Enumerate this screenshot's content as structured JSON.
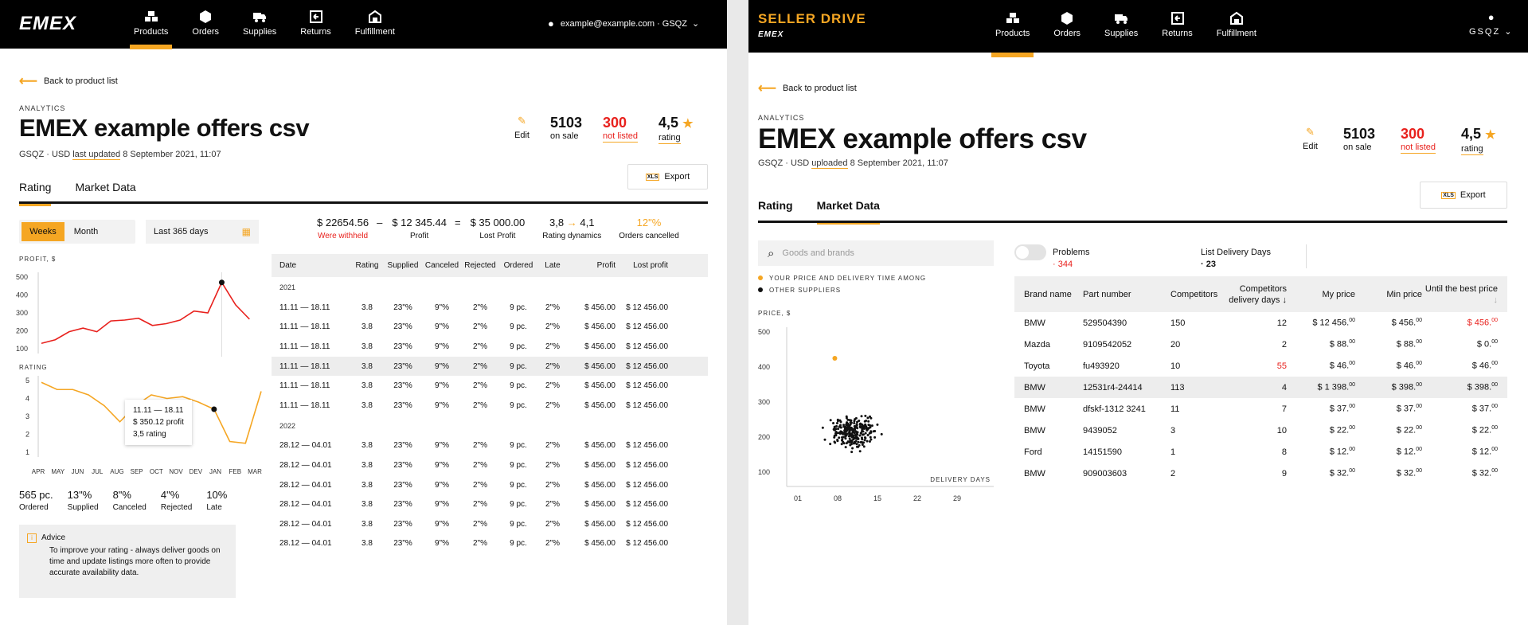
{
  "left": {
    "logo": "EMEX",
    "nav": [
      {
        "label": "Products",
        "icon": "boxes-icon",
        "active": true
      },
      {
        "label": "Orders",
        "icon": "box-icon",
        "active": false
      },
      {
        "label": "Supplies",
        "icon": "truck-icon",
        "active": false
      },
      {
        "label": "Returns",
        "icon": "return-icon",
        "active": false
      },
      {
        "label": "Fulfillment",
        "icon": "warehouse-icon",
        "active": false
      }
    ],
    "account": "example@example.com · GSQZ",
    "back_label": "Back to product list",
    "crumb": "ANALYTICS",
    "title": "EMEX example offers csv",
    "sub_prefix": "GSQZ · USD",
    "sub_link": "last updated",
    "sub_date": "8 September 2021, 11:07",
    "edit_label": "Edit",
    "on_sale_value": "5103",
    "on_sale_label": "on sale",
    "not_listed_value": "300",
    "not_listed_label": "not listed",
    "rating_value": "4,5",
    "rating_label": "rating",
    "export_label": "Export",
    "xls": "XLS",
    "tabs": [
      "Rating",
      "Market Data"
    ],
    "period": {
      "weeks": "Weeks",
      "month": "Month"
    },
    "date_range": "Last 365 days",
    "summary": {
      "withheld": "$ 22654.56",
      "withheld_label": "Were withheld",
      "minus": "–",
      "profit": "$ 12 345.44",
      "profit_label": "Profit",
      "eq": "=",
      "lost": "$ 35 000.00",
      "lost_label": "Lost Profit",
      "dyn_from": "3,8",
      "dyn_to": "4,1",
      "dyn_label": "Rating dynamics",
      "cancelled": "12\"%",
      "cancelled_label": "Orders cancelled"
    },
    "table": {
      "headers": [
        "Date",
        "Rating",
        "Supplied",
        "Canceled",
        "Rejected",
        "Ordered",
        "Late",
        "Profit",
        "Lost profit"
      ],
      "groups": [
        {
          "year": "2021",
          "rows": [
            [
              "11.11 — 18.11",
              "3.8",
              "23\"%",
              "9\"%",
              "2\"%",
              "9 pc.",
              "2\"%",
              "$ 456.00",
              "$ 12 456.00"
            ],
            [
              "11.11 — 18.11",
              "3.8",
              "23\"%",
              "9\"%",
              "2\"%",
              "9 pc.",
              "2\"%",
              "$ 456.00",
              "$ 12 456.00"
            ],
            [
              "11.11 — 18.11",
              "3.8",
              "23\"%",
              "9\"%",
              "2\"%",
              "9 pc.",
              "2\"%",
              "$ 456.00",
              "$ 12 456.00"
            ],
            [
              "11.11 — 18.11",
              "3.8",
              "23\"%",
              "9\"%",
              "2\"%",
              "9 pc.",
              "2\"%",
              "$ 456.00",
              "$ 12 456.00"
            ],
            [
              "11.11 — 18.11",
              "3.8",
              "23\"%",
              "9\"%",
              "2\"%",
              "9 pc.",
              "2\"%",
              "$ 456.00",
              "$ 12 456.00"
            ],
            [
              "11.11 — 18.11",
              "3.8",
              "23\"%",
              "9\"%",
              "2\"%",
              "9 pc.",
              "2\"%",
              "$ 456.00",
              "$ 12 456.00"
            ]
          ]
        },
        {
          "year": "2022",
          "rows": [
            [
              "28.12 — 04.01",
              "3.8",
              "23\"%",
              "9\"%",
              "2\"%",
              "9 pc.",
              "2\"%",
              "$ 456.00",
              "$ 12 456.00"
            ],
            [
              "28.12 — 04.01",
              "3.8",
              "23\"%",
              "9\"%",
              "2\"%",
              "9 pc.",
              "2\"%",
              "$ 456.00",
              "$ 12 456.00"
            ],
            [
              "28.12 — 04.01",
              "3.8",
              "23\"%",
              "9\"%",
              "2\"%",
              "9 pc.",
              "2\"%",
              "$ 456.00",
              "$ 12 456.00"
            ],
            [
              "28.12 — 04.01",
              "3.8",
              "23\"%",
              "9\"%",
              "2\"%",
              "9 pc.",
              "2\"%",
              "$ 456.00",
              "$ 12 456.00"
            ],
            [
              "28.12 — 04.01",
              "3.8",
              "23\"%",
              "9\"%",
              "2\"%",
              "9 pc.",
              "2\"%",
              "$ 456.00",
              "$ 12 456.00"
            ],
            [
              "28.12 — 04.01",
              "3.8",
              "23\"%",
              "9\"%",
              "2\"%",
              "9 pc.",
              "2\"%",
              "$ 456.00",
              "$ 12 456.00"
            ]
          ]
        }
      ],
      "highlighted_row": 3
    },
    "bottom_stats": [
      {
        "v": "565 pc.",
        "l": "Ordered"
      },
      {
        "v": "13\"%",
        "l": "Supplied"
      },
      {
        "v": "8\"%",
        "l": "Canceled"
      },
      {
        "v": "4\"%",
        "l": "Rejected"
      },
      {
        "v": "10%",
        "l": "Late"
      }
    ],
    "advice_title": "Advice",
    "advice_text": "To improve your rating - always deliver goods on time and update listings more often to provide accurate availability data.",
    "tooltip": {
      "l1": "11.11 — 18.11",
      "l2": "$ 350.12 profit",
      "l3": "3,5 rating"
    }
  },
  "right": {
    "logo": "SELLER DRIVE",
    "sublogo": "EMEX",
    "nav": [
      {
        "label": "Products",
        "icon": "boxes-icon",
        "active": true
      },
      {
        "label": "Orders",
        "icon": "box-icon",
        "active": false
      },
      {
        "label": "Supplies",
        "icon": "truck-icon",
        "active": false
      },
      {
        "label": "Returns",
        "icon": "return-icon",
        "active": false
      },
      {
        "label": "Fulfillment",
        "icon": "warehouse-icon",
        "active": false
      }
    ],
    "account": "GSQZ",
    "back_label": "Back to product list",
    "crumb": "ANALYTICS",
    "title": "EMEX example offers csv",
    "sub_prefix": "GSQZ · USD",
    "sub_link": "uploaded",
    "sub_date": "8 September 2021, 11:07",
    "edit_label": "Edit",
    "on_sale_value": "5103",
    "on_sale_label": "on sale",
    "not_listed_value": "300",
    "not_listed_label": "not listed",
    "rating_value": "4,5",
    "rating_label": "rating",
    "export_label": "Export",
    "xls": "XLS",
    "tabs": [
      "Rating",
      "Market Data"
    ],
    "search_placeholder": "Goods and brands",
    "legend1": "YOUR PRICE AND DELIVERY TIME AMONG",
    "legend2": "OTHER SUPPLIERS",
    "problems_label": "Problems",
    "problems_count": "· 344",
    "list_days_label": "List Delivery Days",
    "list_days_count": "· 23",
    "table": {
      "headers": [
        "Brand name",
        "Part number",
        "Competitors",
        "Competitors delivery days",
        "My price",
        "Min price",
        "Until the best price"
      ],
      "rows": [
        {
          "brand": "BMW",
          "part": "529504390",
          "comp": "150",
          "days": "12",
          "days_red": false,
          "my": "$ 12 456.",
          "min": "$ 456.",
          "best": "$ 456.",
          "best_red": true
        },
        {
          "brand": "Mazda",
          "part": "9109542052",
          "comp": "20",
          "days": "2",
          "days_red": false,
          "my": "$ 88.",
          "min": "$ 88.",
          "best": "$ 0.",
          "best_red": false
        },
        {
          "brand": "Toyota",
          "part": "fu493920",
          "comp": "10",
          "days": "55",
          "days_red": true,
          "my": "$ 46.",
          "min": "$ 46.",
          "best": "$ 46.",
          "best_red": false
        },
        {
          "brand": "BMW",
          "part": "12531r4-24414",
          "comp": "113",
          "days": "4",
          "days_red": false,
          "my": "$ 1 398.",
          "min": "$ 398.",
          "best": "$ 398.",
          "best_red": false
        },
        {
          "brand": "BMW",
          "part": "dfskf-1312 3241",
          "comp": "11",
          "days": "7",
          "days_red": false,
          "my": "$ 37.",
          "min": "$ 37.",
          "best": "$ 37.",
          "best_red": false
        },
        {
          "brand": "BMW",
          "part": "9439052",
          "comp": "3",
          "days": "10",
          "days_red": false,
          "my": "$ 22.",
          "min": "$ 22.",
          "best": "$ 22.",
          "best_red": false
        },
        {
          "brand": "Ford",
          "part": "14151590",
          "comp": "1",
          "days": "8",
          "days_red": false,
          "my": "$ 12.",
          "min": "$ 12.",
          "best": "$ 12.",
          "best_red": false
        },
        {
          "brand": "BMW",
          "part": "909003603",
          "comp": "2",
          "days": "9",
          "days_red": false,
          "my": "$ 32.",
          "min": "$ 32.",
          "best": "$ 32.",
          "best_red": false
        }
      ],
      "cents": "00",
      "highlighted_row": 3
    }
  },
  "colors": {
    "accent": "#f5a623",
    "red": "#e8211d",
    "dark": "#000000"
  },
  "chart_data": [
    {
      "type": "line",
      "ylabel": "PROFIT, $",
      "ylim": [
        100,
        500
      ],
      "yticks": [
        100,
        200,
        300,
        400,
        500
      ],
      "series": [
        {
          "values": [
            130,
            150,
            195,
            215,
            195,
            255,
            260,
            270,
            230,
            240,
            260,
            310,
            300,
            470,
            345,
            265
          ]
        }
      ],
      "marker_index": 13
    },
    {
      "type": "line",
      "ylabel": "RATING",
      "ylim": [
        1,
        5
      ],
      "yticks": [
        1,
        2,
        3,
        4,
        5
      ],
      "categories": [
        "APR",
        "MAY",
        "JUN",
        "JUL",
        "AUG",
        "SEP",
        "OCT",
        "NOV",
        "DEV",
        "JAN",
        "FEB",
        "MAR"
      ],
      "series": [
        {
          "values": [
            4.9,
            4.5,
            4.5,
            4.2,
            3.6,
            2.7,
            3.6,
            4.2,
            4.0,
            4.1,
            3.8,
            3.4,
            1.6,
            1.5,
            4.4
          ]
        }
      ],
      "marker_index": 11
    },
    {
      "type": "scatter",
      "ylabel": "PRICE, $",
      "xlabel": "DELIVERY DAYS",
      "xticks": [
        "01",
        "08",
        "15",
        "22",
        "29"
      ],
      "xlim": [
        1,
        29
      ],
      "ylim": [
        100,
        500
      ],
      "yticks": [
        100,
        200,
        300,
        400,
        500
      ],
      "highlight": {
        "x": 7.5,
        "y": 425
      },
      "cluster": {
        "x_center": 11,
        "y_center": 215,
        "x_spread": 3.5,
        "y_spread": 35,
        "count": 260
      }
    }
  ]
}
